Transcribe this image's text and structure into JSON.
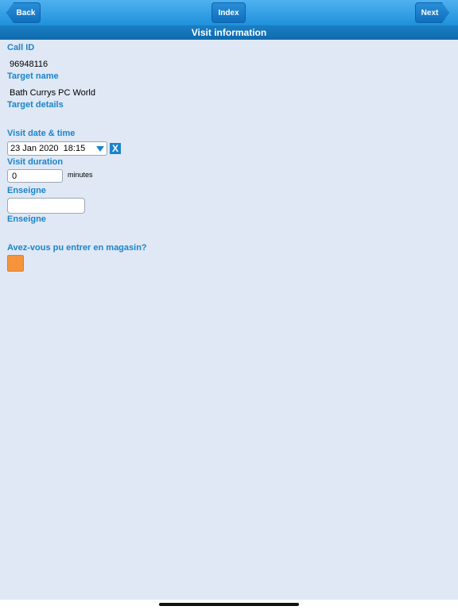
{
  "nav": {
    "back_label": "Back",
    "index_label": "Index",
    "next_label": "Next"
  },
  "page_title": "Visit information",
  "fields": {
    "call_id_label": "Call ID",
    "call_id_value": "96948116",
    "target_name_label": "Target name",
    "target_name_value": "Bath Currys PC World",
    "target_details_label": "Target details",
    "visit_datetime_label": "Visit date & time",
    "visit_datetime_value": "23 Jan 2020  18:15",
    "clear_label": "X",
    "visit_duration_label": "Visit duration",
    "visit_duration_value": "0",
    "duration_unit": "minutes",
    "enseigne_label_1": "Enseigne",
    "enseigne_value": "",
    "enseigne_label_2": "Enseigne",
    "store_access_label": "Avez-vous pu entrer en magasin?"
  },
  "colors": {
    "accent": "#1a84cc",
    "background": "#dfe8f4",
    "checkbox": "#f5943c"
  }
}
